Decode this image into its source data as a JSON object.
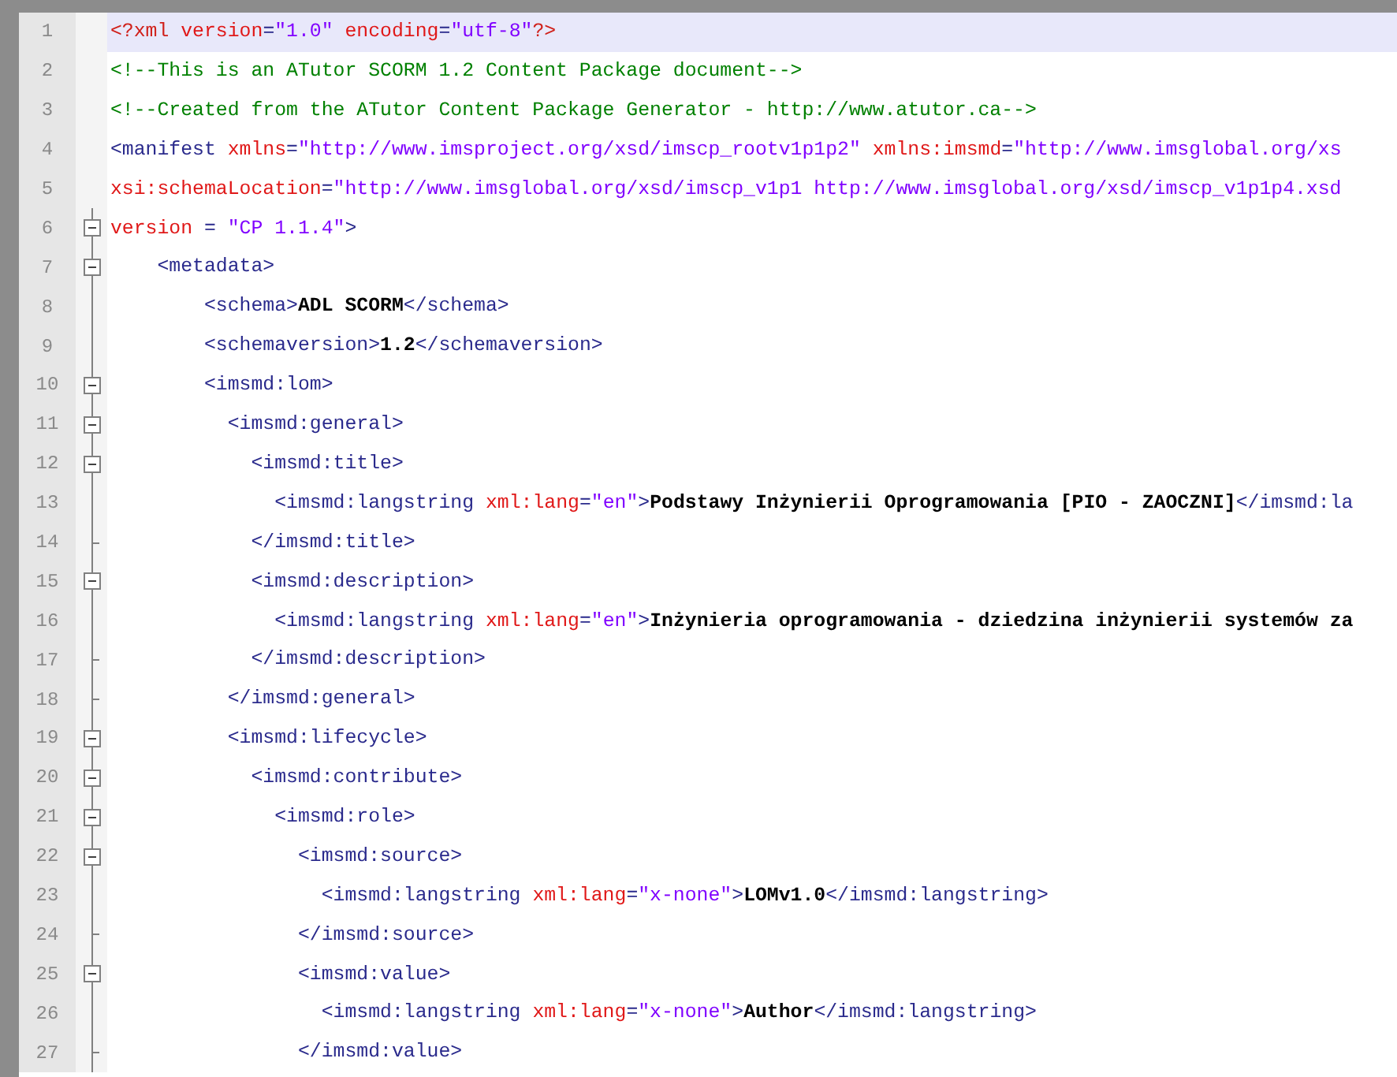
{
  "editor": {
    "lines": [
      {
        "number": "1",
        "kind": "plain",
        "selected": true,
        "tokens": [
          {
            "kind": "decl",
            "text": "<?xml "
          },
          {
            "kind": "attr",
            "text": "version"
          },
          {
            "kind": "tag",
            "text": "="
          },
          {
            "kind": "value",
            "text": "\"1.0\" "
          },
          {
            "kind": "attr",
            "text": "encoding"
          },
          {
            "kind": "tag",
            "text": "="
          },
          {
            "kind": "value",
            "text": "\"utf-8\""
          },
          {
            "kind": "decl",
            "text": "?>"
          }
        ]
      },
      {
        "number": "2",
        "kind": "plain",
        "selected": false,
        "tokens": [
          {
            "kind": "comment",
            "text": "<!--This is an ATutor SCORM 1.2 Content Package document-->"
          }
        ]
      },
      {
        "number": "3",
        "kind": "plain",
        "selected": false,
        "tokens": [
          {
            "kind": "comment",
            "text": "<!--Created from the ATutor Content Package Generator - http://www.atutor.ca-->"
          }
        ]
      },
      {
        "number": "4",
        "kind": "plain",
        "selected": false,
        "tokens": [
          {
            "kind": "tag",
            "text": "<manifest "
          },
          {
            "kind": "attr",
            "text": "xmlns"
          },
          {
            "kind": "tag",
            "text": "="
          },
          {
            "kind": "value",
            "text": "\"http://www.imsproject.org/xsd/imscp_rootv1p1p2\" "
          },
          {
            "kind": "attr",
            "text": "xmlns:imsmd"
          },
          {
            "kind": "tag",
            "text": "="
          },
          {
            "kind": "value",
            "text": "\"http://www.imsglobal.org/xs"
          }
        ]
      },
      {
        "number": "5",
        "kind": "plain",
        "selected": false,
        "tokens": [
          {
            "kind": "attr",
            "text": "xsi:schemaLocation"
          },
          {
            "kind": "tag",
            "text": "="
          },
          {
            "kind": "value",
            "text": "\"http://www.imsglobal.org/xsd/imscp_v1p1 http://www.imsglobal.org/xsd/imscp_v1p1p4.xsd"
          }
        ]
      },
      {
        "number": "6",
        "kind": "open",
        "selected": false,
        "tokens": [
          {
            "kind": "attr",
            "text": "version"
          },
          {
            "kind": "tag",
            "text": " = "
          },
          {
            "kind": "value",
            "text": "\"CP 1.1.4\""
          },
          {
            "kind": "tag",
            "text": ">"
          }
        ]
      },
      {
        "number": "7",
        "kind": "open",
        "selected": false,
        "tokens": [
          {
            "kind": "tag",
            "text": "    <metadata>"
          }
        ]
      },
      {
        "number": "8",
        "kind": "inner",
        "selected": false,
        "tokens": [
          {
            "kind": "tag",
            "text": "        <schema>"
          },
          {
            "kind": "text",
            "text": "ADL SCORM"
          },
          {
            "kind": "tag",
            "text": "</schema>"
          }
        ]
      },
      {
        "number": "9",
        "kind": "inner",
        "selected": false,
        "tokens": [
          {
            "kind": "tag",
            "text": "        <schemaversion>"
          },
          {
            "kind": "text",
            "text": "1.2"
          },
          {
            "kind": "tag",
            "text": "</schemaversion>"
          }
        ]
      },
      {
        "number": "10",
        "kind": "open",
        "selected": false,
        "tokens": [
          {
            "kind": "tag",
            "text": "        <imsmd:lom>"
          }
        ]
      },
      {
        "number": "11",
        "kind": "open",
        "selected": false,
        "tokens": [
          {
            "kind": "tag",
            "text": "          <imsmd:general>"
          }
        ]
      },
      {
        "number": "12",
        "kind": "open",
        "selected": false,
        "tokens": [
          {
            "kind": "tag",
            "text": "            <imsmd:title>"
          }
        ]
      },
      {
        "number": "13",
        "kind": "inner",
        "selected": false,
        "tokens": [
          {
            "kind": "tag",
            "text": "              <imsmd:langstring "
          },
          {
            "kind": "attr",
            "text": "xml:lang"
          },
          {
            "kind": "tag",
            "text": "="
          },
          {
            "kind": "value",
            "text": "\"en\""
          },
          {
            "kind": "tag",
            "text": ">"
          },
          {
            "kind": "text",
            "text": "Podstawy Inżynierii Oprogramowania [PIO - ZAOCZNI]"
          },
          {
            "kind": "tag",
            "text": "</imsmd:la"
          }
        ]
      },
      {
        "number": "14",
        "kind": "end",
        "selected": false,
        "tokens": [
          {
            "kind": "tag",
            "text": "            </imsmd:title>"
          }
        ]
      },
      {
        "number": "15",
        "kind": "open",
        "selected": false,
        "tokens": [
          {
            "kind": "tag",
            "text": "            <imsmd:description>"
          }
        ]
      },
      {
        "number": "16",
        "kind": "inner",
        "selected": false,
        "tokens": [
          {
            "kind": "tag",
            "text": "              <imsmd:langstring "
          },
          {
            "kind": "attr",
            "text": "xml:lang"
          },
          {
            "kind": "tag",
            "text": "="
          },
          {
            "kind": "value",
            "text": "\"en\""
          },
          {
            "kind": "tag",
            "text": ">"
          },
          {
            "kind": "text",
            "text": "Inżynieria oprogramowania - dziedzina inżynierii systemów za"
          }
        ]
      },
      {
        "number": "17",
        "kind": "end",
        "selected": false,
        "tokens": [
          {
            "kind": "tag",
            "text": "            </imsmd:description>"
          }
        ]
      },
      {
        "number": "18",
        "kind": "end",
        "selected": false,
        "tokens": [
          {
            "kind": "tag",
            "text": "          </imsmd:general>"
          }
        ]
      },
      {
        "number": "19",
        "kind": "open",
        "selected": false,
        "tokens": [
          {
            "kind": "tag",
            "text": "          <imsmd:lifecycle>"
          }
        ]
      },
      {
        "number": "20",
        "kind": "open",
        "selected": false,
        "tokens": [
          {
            "kind": "tag",
            "text": "            <imsmd:contribute>"
          }
        ]
      },
      {
        "number": "21",
        "kind": "open",
        "selected": false,
        "tokens": [
          {
            "kind": "tag",
            "text": "              <imsmd:role>"
          }
        ]
      },
      {
        "number": "22",
        "kind": "open",
        "selected": false,
        "tokens": [
          {
            "kind": "tag",
            "text": "                <imsmd:source>"
          }
        ]
      },
      {
        "number": "23",
        "kind": "inner",
        "selected": false,
        "tokens": [
          {
            "kind": "tag",
            "text": "                  <imsmd:langstring "
          },
          {
            "kind": "attr",
            "text": "xml:lang"
          },
          {
            "kind": "tag",
            "text": "="
          },
          {
            "kind": "value",
            "text": "\"x-none\""
          },
          {
            "kind": "tag",
            "text": ">"
          },
          {
            "kind": "text",
            "text": "LOMv1.0"
          },
          {
            "kind": "tag",
            "text": "</imsmd:langstring>"
          }
        ]
      },
      {
        "number": "24",
        "kind": "end",
        "selected": false,
        "tokens": [
          {
            "kind": "tag",
            "text": "                </imsmd:source>"
          }
        ]
      },
      {
        "number": "25",
        "kind": "open",
        "selected": false,
        "tokens": [
          {
            "kind": "tag",
            "text": "                <imsmd:value>"
          }
        ]
      },
      {
        "number": "26",
        "kind": "inner",
        "selected": false,
        "tokens": [
          {
            "kind": "tag",
            "text": "                  <imsmd:langstring "
          },
          {
            "kind": "attr",
            "text": "xml:lang"
          },
          {
            "kind": "tag",
            "text": "="
          },
          {
            "kind": "value",
            "text": "\"x-none\""
          },
          {
            "kind": "tag",
            "text": ">"
          },
          {
            "kind": "text",
            "text": "Author"
          },
          {
            "kind": "tag",
            "text": "</imsmd:langstring>"
          }
        ]
      },
      {
        "number": "27",
        "kind": "end",
        "selected": false,
        "tokens": [
          {
            "kind": "tag",
            "text": "                </imsmd:value>"
          }
        ]
      }
    ]
  }
}
